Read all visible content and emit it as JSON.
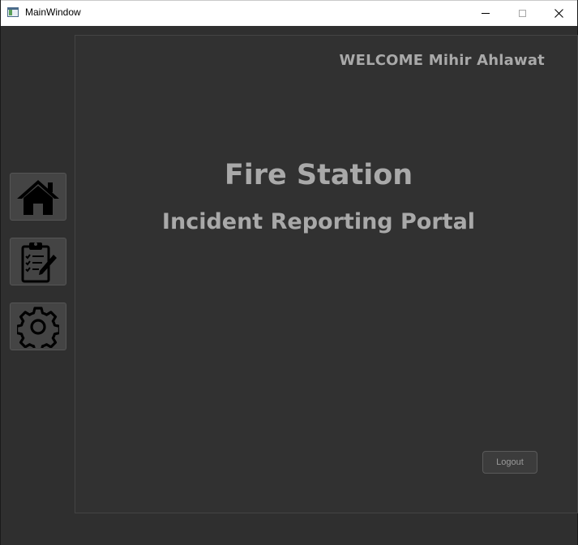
{
  "window": {
    "title": "MainWindow",
    "icons": {
      "app": "app-window-icon",
      "minimize": "minimize-icon",
      "maximize": "maximize-icon",
      "close": "close-icon"
    }
  },
  "header": {
    "welcome": "WELCOME Mihir Ahlawat"
  },
  "main": {
    "title": "Fire Station",
    "subtitle": "Incident Reporting Portal",
    "logout_label": "Logout"
  },
  "sidebar": {
    "items": [
      {
        "icon": "home-icon"
      },
      {
        "icon": "clipboard-checklist-icon"
      },
      {
        "icon": "gear-icon"
      }
    ]
  },
  "colors": {
    "background": "#2f2f2f",
    "text": "#a9a9a9",
    "button": "#444444"
  }
}
